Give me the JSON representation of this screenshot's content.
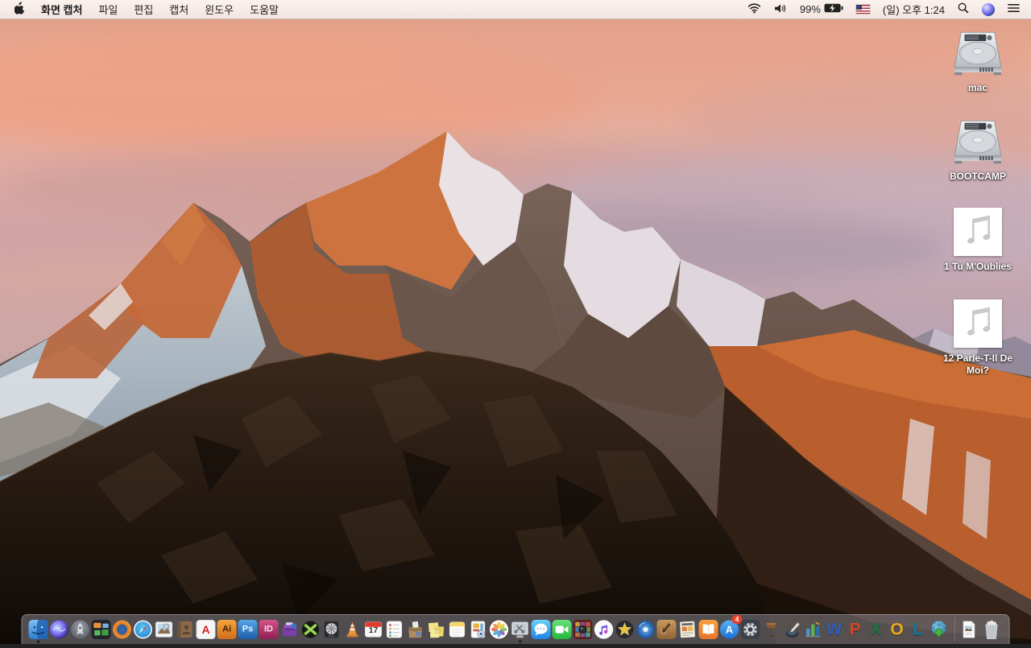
{
  "menu_bar": {
    "items": [
      "화면 캡처",
      "파일",
      "편집",
      "캡처",
      "윈도우",
      "도움말"
    ],
    "status": {
      "battery_percent": "99%",
      "clock": "(일) 오후 1:24"
    },
    "status_icons": [
      "wifi-icon",
      "volume-icon",
      "battery-charging-icon",
      "us-flag-icon",
      "spotlight-search-icon",
      "siri-icon",
      "notification-center-icon"
    ]
  },
  "desktop": {
    "icons": [
      {
        "kind": "hard-drive",
        "label": "mac"
      },
      {
        "kind": "hard-drive",
        "label": "BOOTCAMP"
      },
      {
        "kind": "audio-file",
        "label": "1 Tu M'Oublies"
      },
      {
        "kind": "audio-file",
        "label": "12 Parle-T-Il De Moi?"
      }
    ]
  },
  "dock": {
    "items": [
      {
        "icon": "finder",
        "running": true
      },
      {
        "icon": "siri"
      },
      {
        "icon": "launchpad"
      },
      {
        "icon": "mission-control"
      },
      {
        "icon": "firefox"
      },
      {
        "icon": "safari"
      },
      {
        "icon": "preview"
      },
      {
        "icon": "contacts"
      },
      {
        "icon": "acrobat",
        "glyph": "A"
      },
      {
        "icon": "illustrator",
        "glyph": "Ai"
      },
      {
        "icon": "photoshop",
        "glyph": "Ps"
      },
      {
        "icon": "indesign",
        "glyph": "ID"
      },
      {
        "icon": "toast"
      },
      {
        "icon": "green-x"
      },
      {
        "icon": "fan-drive"
      },
      {
        "icon": "vlc"
      },
      {
        "icon": "calendar",
        "glyph": "17"
      },
      {
        "icon": "reminders"
      },
      {
        "icon": "unarchiver"
      },
      {
        "icon": "stickies"
      },
      {
        "icon": "notes"
      },
      {
        "icon": "templates"
      },
      {
        "icon": "photos"
      },
      {
        "icon": "grab",
        "running": true
      },
      {
        "icon": "messages"
      },
      {
        "icon": "facetime"
      },
      {
        "icon": "photo-booth"
      },
      {
        "icon": "itunes"
      },
      {
        "icon": "imovie"
      },
      {
        "icon": "dvd"
      },
      {
        "icon": "garageband"
      },
      {
        "icon": "comic-life"
      },
      {
        "icon": "ibooks"
      },
      {
        "icon": "app-store",
        "glyph": "A",
        "badge": "4"
      },
      {
        "icon": "system-preferences"
      },
      {
        "icon": "keynote"
      },
      {
        "icon": "pages"
      },
      {
        "icon": "numbers"
      },
      {
        "icon": "word",
        "glyph": "W"
      },
      {
        "icon": "powerpoint",
        "glyph": "P"
      },
      {
        "icon": "excel",
        "glyph": "X"
      },
      {
        "icon": "outlook",
        "glyph": "O"
      },
      {
        "icon": "lync",
        "glyph": "L"
      },
      {
        "icon": "downloader"
      },
      {
        "divider": true
      },
      {
        "icon": "image-file"
      },
      {
        "icon": "trash"
      }
    ]
  }
}
